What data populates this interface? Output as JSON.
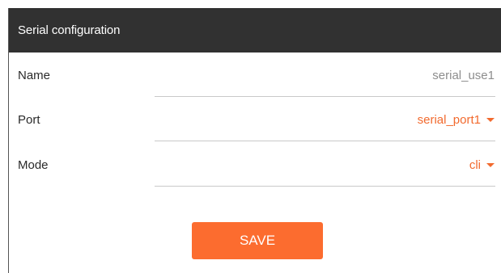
{
  "panel": {
    "title": "Serial configuration"
  },
  "fields": {
    "name": {
      "label": "Name",
      "value": "serial_use1"
    },
    "port": {
      "label": "Port",
      "value": "serial_port1"
    },
    "mode": {
      "label": "Mode",
      "value": "cli"
    }
  },
  "actions": {
    "save_label": "SAVE"
  },
  "colors": {
    "header_bg": "#313131",
    "accent": "#fc6c2f",
    "select_text": "#f26a2e",
    "muted_text": "#8d8d8d"
  },
  "icons": {
    "dropdown": "caret-down-icon"
  }
}
